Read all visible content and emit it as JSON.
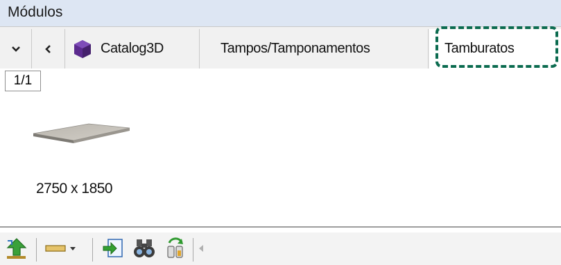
{
  "window": {
    "title": "Módulos"
  },
  "tabs": {
    "items": [
      {
        "label": "Catalog3D",
        "icon": "purple-cube-icon",
        "active": false
      },
      {
        "label": "Tampos/Tamponamentos",
        "active": false
      },
      {
        "label": "Tamburatos",
        "active": true
      }
    ]
  },
  "nav": {
    "dropdown_glyph": "⌄",
    "prev_glyph": "‹"
  },
  "pager": {
    "label": "1/1"
  },
  "module": {
    "caption": "2750 x 1850",
    "icon": "panel-board-icon"
  },
  "toolbar": {
    "icons": [
      "green-up-arrow-icon",
      "line-style-dropdown-icon",
      "import-arrow-icon",
      "binoculars-icon",
      "refresh-bottles-icon",
      "scroll-left-icon"
    ]
  },
  "colors": {
    "accent": "#0b6b4f",
    "titlebar": "#dde6f3",
    "cube": "#5b2a8e"
  }
}
